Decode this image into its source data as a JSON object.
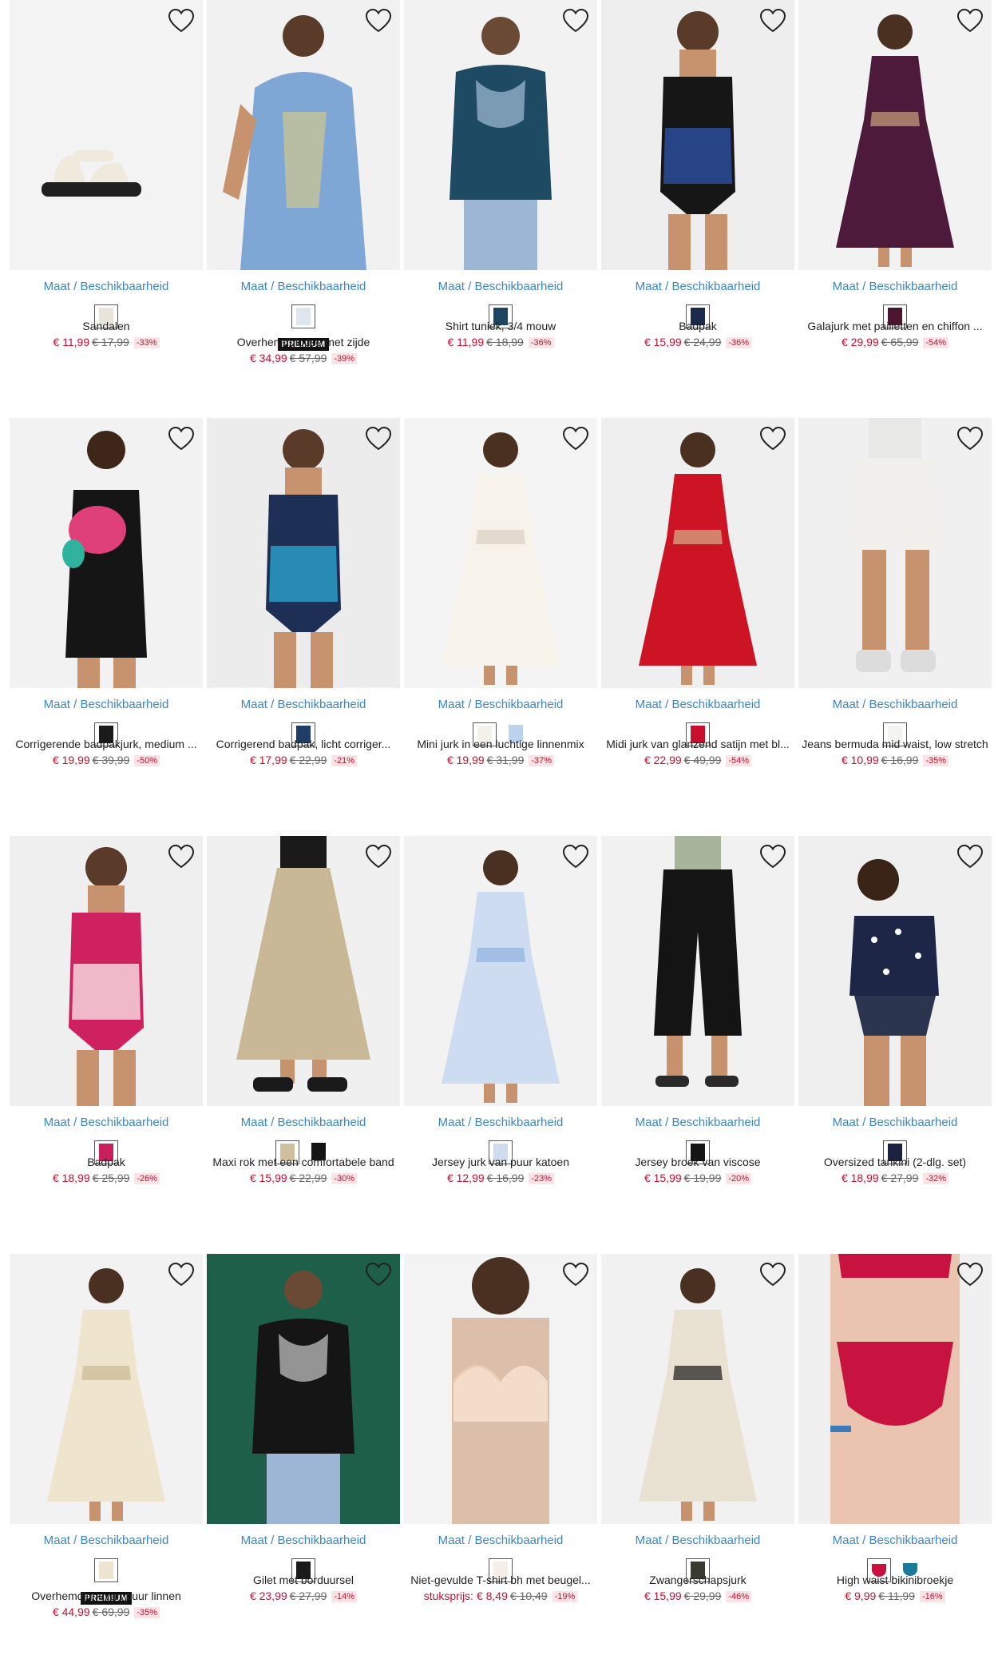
{
  "availability_label": "Maat / Beschikbaarheid",
  "premium_label": "PREMIUM",
  "products": [
    {
      "name": "Sandalen",
      "price": "€ 11,99",
      "old_price": "€ 17,99",
      "discount": "-33%",
      "swatches": [
        {
          "color": "#e9e5da",
          "selected": true
        }
      ],
      "photo_bg": "#f3f3f3",
      "photo_main": "#efeadb",
      "photo_accent": "#202020",
      "kind": "shoe"
    },
    {
      "name": "Overhemdblouse met zijde",
      "price": "€ 34,99",
      "old_price": "€ 57,99",
      "discount": "-39%",
      "premium": true,
      "swatches": [
        {
          "color": "#dfe6ee",
          "selected": true
        }
      ],
      "photo_bg": "#f1f1f1",
      "photo_main": "#7fa7d6",
      "photo_accent": "#e7d27a",
      "kind": "shirt"
    },
    {
      "name": "Shirt tuniek, 3/4 mouw",
      "price": "€ 11,99",
      "old_price": "€ 18,99",
      "discount": "-36%",
      "swatches": [
        {
          "color": "#1f4660",
          "selected": true
        }
      ],
      "photo_bg": "#f2f2f2",
      "photo_main": "#1f4a63",
      "photo_accent": "#b9d0ea",
      "kind": "top"
    },
    {
      "name": "Badpak",
      "price": "€ 15,99",
      "old_price": "€ 24,99",
      "discount": "-36%",
      "swatches": [
        {
          "color": "#1b2a4a",
          "selected": true
        }
      ],
      "photo_bg": "#eeeeee",
      "photo_main": "#161616",
      "photo_accent": "#2a4e9a",
      "kind": "swim"
    },
    {
      "name": "Galajurk met pailletten en chiffon ...",
      "price": "€ 29,99",
      "old_price": "€ 65,99",
      "discount": "-54%",
      "swatches": [
        {
          "color": "#4a1630",
          "selected": true
        }
      ],
      "photo_bg": "#f2f2f2",
      "photo_main": "#4e1a3c",
      "photo_accent": "#c9a27a",
      "kind": "dress"
    },
    {
      "name": "Corrigerende badpakjurk, medium ...",
      "price": "€ 19,99",
      "old_price": "€ 39,99",
      "discount": "-50%",
      "swatches": [
        {
          "color": "#1a1a1a",
          "selected": true
        }
      ],
      "photo_bg": "#f2f2f2",
      "photo_main": "#151515",
      "photo_accent": "#e0407a",
      "kind": "tankdress"
    },
    {
      "name": "Corrigerend badpak, licht corriger...",
      "price": "€ 17,99",
      "old_price": "€ 22,99",
      "discount": "-21%",
      "swatches": [
        {
          "color": "#1f3d66",
          "selected": true
        }
      ],
      "photo_bg": "#ececec",
      "photo_main": "#1d2f55",
      "photo_accent": "#2a9bc4",
      "kind": "swim"
    },
    {
      "name": "Mini jurk in een luchtige linnenmix",
      "price": "€ 19,99",
      "old_price": "€ 31,99",
      "discount": "-37%",
      "swatches": [
        {
          "color": "#f4f1ea",
          "selected": true
        },
        {
          "color": "#bcd2ee",
          "selected": false
        }
      ],
      "photo_bg": "#f4f4f4",
      "photo_main": "#f7f3ea",
      "photo_accent": "#d8cfbf",
      "kind": "dress"
    },
    {
      "name": "Midi jurk van glanzend satijn met bl...",
      "price": "€ 22,99",
      "old_price": "€ 49,99",
      "discount": "-54%",
      "swatches": [
        {
          "color": "#c8102e",
          "selected": true
        }
      ],
      "photo_bg": "#efefef",
      "photo_main": "#cc1425",
      "photo_accent": "#d9b08c",
      "kind": "dress"
    },
    {
      "name": "Jeans bermuda mid waist, low stretch",
      "price": "€ 10,99",
      "old_price": "€ 16,99",
      "discount": "-35%",
      "swatches": [
        {
          "color": "#f3f3f1",
          "selected": true
        }
      ],
      "photo_bg": "#f0f0f0",
      "photo_main": "#f1f0ec",
      "photo_accent": "#b9c5d8",
      "kind": "shorts"
    },
    {
      "name": "Badpak",
      "price": "€ 18,99",
      "old_price": "€ 25,99",
      "discount": "-26%",
      "swatches": [
        {
          "color": "#c8205a",
          "selected": true
        }
      ],
      "photo_bg": "#efefef",
      "photo_main": "#cf2160",
      "photo_accent": "#f6d3dc",
      "kind": "swim"
    },
    {
      "name": "Maxi rok met een comfortabele band",
      "price": "€ 15,99",
      "old_price": "€ 22,99",
      "discount": "-30%",
      "swatches": [
        {
          "color": "#cfbf9f",
          "selected": true
        },
        {
          "color": "#141414",
          "selected": false
        }
      ],
      "photo_bg": "#f0f0f0",
      "photo_main": "#c9b896",
      "photo_accent": "#1a1a1a",
      "kind": "skirt"
    },
    {
      "name": "Jersey jurk van puur katoen",
      "price": "€ 12,99",
      "old_price": "€ 16,99",
      "discount": "-23%",
      "swatches": [
        {
          "color": "#cfdcf0",
          "selected": true
        }
      ],
      "photo_bg": "#f2f2f2",
      "photo_main": "#cddcf1",
      "photo_accent": "#8fb0de",
      "kind": "dress"
    },
    {
      "name": "Jersey broek van viscose",
      "price": "€ 15,99",
      "old_price": "€ 19,99",
      "discount": "-20%",
      "swatches": [
        {
          "color": "#151515",
          "selected": true
        }
      ],
      "photo_bg": "#f1f1f1",
      "photo_main": "#141414",
      "photo_accent": "#a9b59a",
      "kind": "pants"
    },
    {
      "name": "Oversized tankini (2-dlg. set)",
      "price": "€ 18,99",
      "old_price": "€ 27,99",
      "discount": "-32%",
      "swatches": [
        {
          "color": "#1c2340",
          "selected": true
        }
      ],
      "photo_bg": "#efefef",
      "photo_main": "#1e2648",
      "photo_accent": "#ffffff",
      "kind": "tankini"
    },
    {
      "name": "Overhemdjurk van puur linnen",
      "price": "€ 44,99",
      "old_price": "€ 69,99",
      "discount": "-35%",
      "premium": true,
      "swatches": [
        {
          "color": "#eee4cf",
          "selected": true
        }
      ],
      "photo_bg": "#f2f2f2",
      "photo_main": "#efe5cf",
      "photo_accent": "#cbb993",
      "kind": "dress"
    },
    {
      "name": "Gilet met borduursel",
      "price": "€ 23,99",
      "old_price": "€ 27,99",
      "discount": "-14%",
      "swatches": [
        {
          "color": "#1a1a1a",
          "selected": true
        }
      ],
      "photo_bg": "#1e5f4a",
      "photo_main": "#151515",
      "photo_accent": "#eaeaea",
      "kind": "top"
    },
    {
      "name": "Niet-gevulde T-shirt bh met beugel...",
      "price": "€ 8,49",
      "old_price": "€ 10,49",
      "discount": "-19%",
      "unit_label": "stuksprijs:",
      "swatches": [
        {
          "color": "#f6efe8",
          "selected": true
        }
      ],
      "photo_bg": "#f3f3f3",
      "photo_main": "#f3dcc9",
      "photo_accent": "#e8c9b1",
      "kind": "bra"
    },
    {
      "name": "Zwangerschapsjurk",
      "price": "€ 15,99",
      "old_price": "€ 29,99",
      "discount": "-46%",
      "swatches": [
        {
          "color": "#3a3a30",
          "selected": true
        }
      ],
      "photo_bg": "#f1f1f1",
      "photo_main": "#e9e2d3",
      "photo_accent": "#1a1a1a",
      "kind": "dress"
    },
    {
      "name": "High waist bikinibroekje",
      "price": "€ 9,99",
      "old_price": "€ 11,99",
      "discount": "-16%",
      "swatches": [
        {
          "color": "#c8123f",
          "selected": true,
          "shape": "heart"
        },
        {
          "color": "#1a7a9a",
          "selected": false,
          "shape": "heart"
        }
      ],
      "photo_bg": "#f0f0f0",
      "photo_main": "#c8123f",
      "photo_accent": "#e9b99e",
      "kind": "bikini"
    }
  ]
}
